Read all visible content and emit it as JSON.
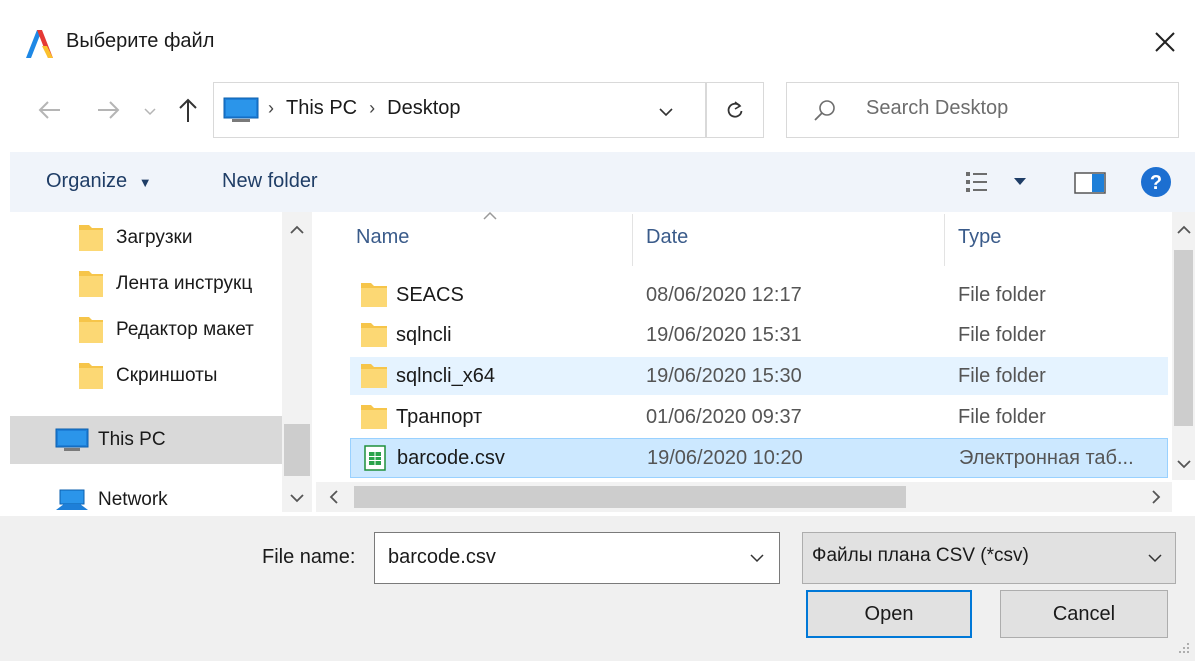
{
  "window": {
    "title": "Выберите файл",
    "close_icon": "close-icon"
  },
  "nav": {
    "breadcrumb": [
      "This PC",
      "Desktop"
    ],
    "search_placeholder": "Search Desktop"
  },
  "toolbar": {
    "organize_label": "Organize",
    "new_folder_label": "New folder"
  },
  "sidebar": {
    "items": [
      {
        "label": "Загрузки",
        "icon": "folder-icon"
      },
      {
        "label": "Лента инструкц",
        "icon": "folder-icon"
      },
      {
        "label": "Редактор макет",
        "icon": "folder-icon"
      },
      {
        "label": "Скриншоты",
        "icon": "folder-icon"
      },
      {
        "label": "This PC",
        "icon": "computer-icon",
        "selected": true
      },
      {
        "label": "Network",
        "icon": "network-icon"
      }
    ]
  },
  "filelist": {
    "columns": {
      "name": "Name",
      "date": "Date",
      "type": "Type"
    },
    "rows": [
      {
        "name": "SEACS",
        "date": "08/06/2020 12:17",
        "type": "File folder",
        "icon": "folder-icon"
      },
      {
        "name": "sqlncli",
        "date": "19/06/2020 15:31",
        "type": "File folder",
        "icon": "folder-icon"
      },
      {
        "name": "sqlncli_x64",
        "date": "19/06/2020 15:30",
        "type": "File folder",
        "icon": "folder-icon",
        "state": "hover"
      },
      {
        "name": "Транпорт",
        "date": "01/06/2020 09:37",
        "type": "File folder",
        "icon": "folder-icon"
      },
      {
        "name": "barcode.csv",
        "date": "19/06/2020 10:20",
        "type": "Электронная таб...",
        "icon": "spreadsheet-icon",
        "state": "selected"
      }
    ]
  },
  "bottom": {
    "file_name_label": "File name:",
    "file_name_value": "barcode.csv",
    "file_type_value": "Файлы плана CSV (*csv)",
    "open_label": "Open",
    "cancel_label": "Cancel"
  },
  "colors": {
    "accent": "#0078d7",
    "selection": "#cce8ff",
    "hover": "#e5f3ff",
    "folder": "#f6c54a",
    "help": "#1c6fd1"
  }
}
